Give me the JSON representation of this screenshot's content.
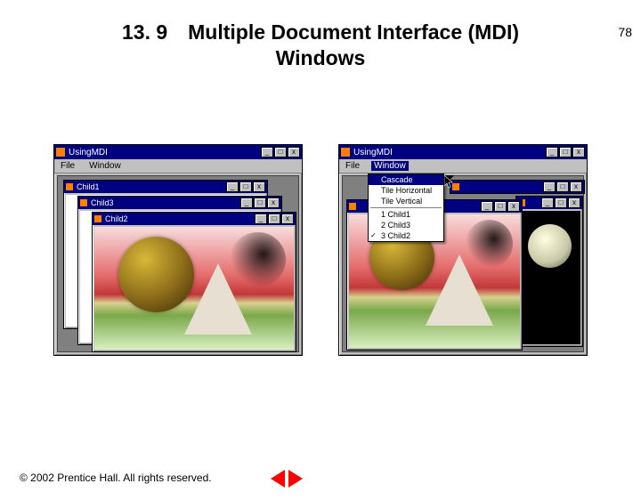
{
  "page_number": "78",
  "title_line1": "13. 9 Multiple Document Interface (MDI)",
  "title_line2": "Windows",
  "footer": "© 2002 Prentice Hall.  All rights reserved.",
  "parent_app_title": "UsingMDI",
  "menubar": {
    "file": "File",
    "window": "Window"
  },
  "winbtns": {
    "min": "_",
    "max": "□",
    "close": "x"
  },
  "left": {
    "children": [
      {
        "title": "Child1"
      },
      {
        "title": "Child3"
      },
      {
        "title": "Child2"
      }
    ]
  },
  "right": {
    "dropdown": {
      "cascade": "Cascade",
      "tile_h": "Tile Horizontal",
      "tile_v": "Tile Vertical",
      "child1": "1 Child1",
      "child2": "2 Child3",
      "child3": "3 Child2"
    }
  }
}
